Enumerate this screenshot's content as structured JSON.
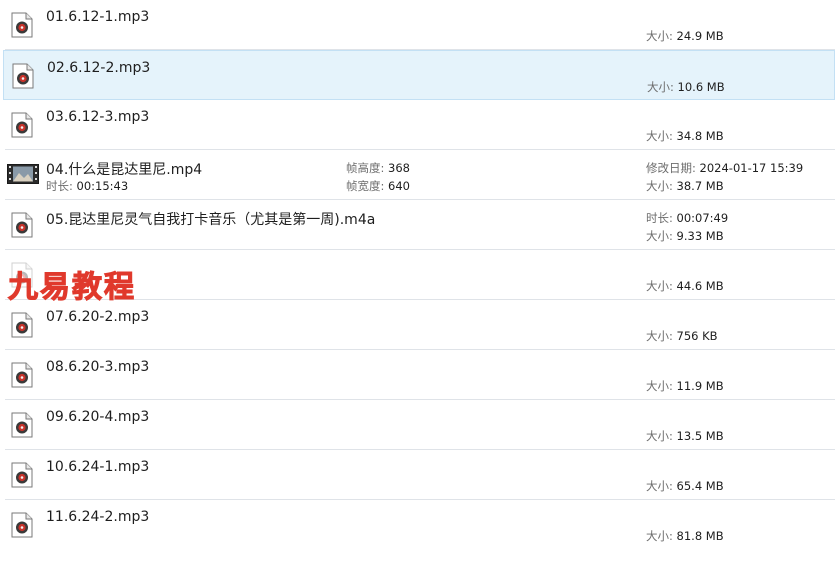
{
  "labels": {
    "size": "大小:",
    "modified": "修改日期:",
    "duration": "时长:",
    "frame_height": "帧高度:",
    "frame_width": "帧宽度:"
  },
  "files": [
    {
      "name": "01.6.12-1.mp3",
      "type": "audio",
      "size": "24.9 MB"
    },
    {
      "name": "02.6.12-2.mp3",
      "type": "audio",
      "size": "10.6 MB",
      "selected": true
    },
    {
      "name": "03.6.12-3.mp3",
      "type": "audio",
      "size": "34.8 MB"
    },
    {
      "name": "04.什么是昆达里尼.mp4",
      "type": "video",
      "size": "38.7 MB",
      "modified": "2024-01-17 15:39",
      "duration": "00:15:43",
      "frame_height": "368",
      "frame_width": "640"
    },
    {
      "name": "05.昆达里尼灵气自我打卡音乐（尤其是第一周).m4a",
      "type": "audio",
      "size": "9.33 MB",
      "duration": "00:07:49"
    },
    {
      "name": "",
      "type": "audio",
      "size": "44.6 MB"
    },
    {
      "name": "07.6.20-2.mp3",
      "type": "audio",
      "size": "756 KB"
    },
    {
      "name": "08.6.20-3.mp3",
      "type": "audio",
      "size": "11.9 MB"
    },
    {
      "name": "09.6.20-4.mp3",
      "type": "audio",
      "size": "13.5 MB"
    },
    {
      "name": "10.6.24-1.mp3",
      "type": "audio",
      "size": "65.4 MB"
    },
    {
      "name": "11.6.24-2.mp3",
      "type": "audio",
      "size": "81.8 MB"
    }
  ],
  "watermark": "九易教程",
  "colors": {
    "selected_bg": "#e5f3fb",
    "watermark": "#e0392c"
  },
  "icons": {
    "audio": "audio-file-icon",
    "video": "video-file-icon"
  }
}
